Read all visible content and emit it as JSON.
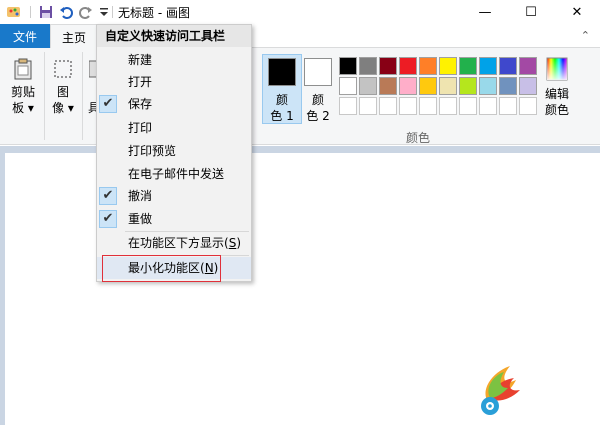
{
  "window": {
    "title": "无标题 - 画图",
    "controls": {
      "minimize": "—",
      "maximize": "☐",
      "close": "✕"
    }
  },
  "qat": {
    "icons": [
      "paint-app-icon",
      "save-icon",
      "undo-icon",
      "redo-icon",
      "customize-dropdown-icon"
    ]
  },
  "tabs": {
    "file": "文件",
    "home": "主页"
  },
  "ribbon": {
    "clipboard": {
      "line1": "剪贴",
      "line2": "板 ▾"
    },
    "image": {
      "line1": "图",
      "line2": "像 ▾"
    },
    "tools_partial": "具",
    "color1": {
      "line1": "颜",
      "line2": "色 1",
      "value": "#000000"
    },
    "color2": {
      "line1": "颜",
      "line2": "色 2",
      "value": "#ffffff"
    },
    "edit_colors": {
      "line1": "编辑",
      "line2": "颜色"
    },
    "colors_group_label": "颜色",
    "palette": [
      "#000000",
      "#7f7f7f",
      "#880015",
      "#ed1c24",
      "#ff7f27",
      "#fff200",
      "#22b14c",
      "#00a2e8",
      "#3f48cc",
      "#a349a4",
      "#ffffff",
      "#c3c3c3",
      "#b97a57",
      "#ffaec9",
      "#ffc90e",
      "#efe4b0",
      "#b5e61d",
      "#99d9ea",
      "#7092be",
      "#c8bfe7",
      "#ffffff",
      "#ffffff",
      "#ffffff",
      "#ffffff",
      "#ffffff",
      "#ffffff",
      "#ffffff",
      "#ffffff",
      "#ffffff",
      "#ffffff"
    ]
  },
  "menu": {
    "header": "自定义快速访问工具栏",
    "items": [
      {
        "label": "新建",
        "checked": false
      },
      {
        "label": "打开",
        "checked": false
      },
      {
        "label": "保存",
        "checked": true
      },
      {
        "label": "打印",
        "checked": false
      },
      {
        "label": "打印预览",
        "checked": false
      },
      {
        "label": "在电子邮件中发送",
        "checked": false
      },
      {
        "label": "撤消",
        "checked": true
      },
      {
        "label": "重做",
        "checked": true
      }
    ],
    "show_below": {
      "text": "在功能区下方显示(",
      "key": "S",
      "end": ")"
    },
    "minimize": {
      "text": "最小化功能区(",
      "key": "N",
      "end": ")"
    }
  }
}
